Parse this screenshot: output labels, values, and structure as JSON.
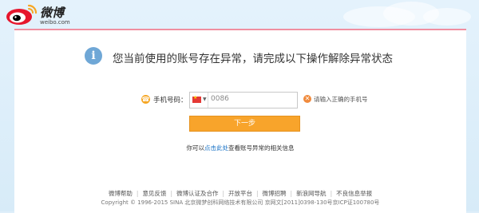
{
  "brand": {
    "name": "微博",
    "domain": "weibo.com"
  },
  "notice": {
    "text": "您当前使用的账号存在异常，请完成以下操作解除异常状态"
  },
  "phone": {
    "label": "手机号码：",
    "country_code": "0086",
    "value": "",
    "error_text": "请输入正确的手机号"
  },
  "next_button": {
    "label": "下一步"
  },
  "help": {
    "prefix": "你可以",
    "link": "点击此处",
    "suffix": "查看账号异常的相关信息"
  },
  "footer": {
    "links": [
      "微博帮助",
      "意见反馈",
      "微博认证及合作",
      "开放平台",
      "微博招聘",
      "新浪网导航",
      "不良信息举报"
    ],
    "copyright": "Copyright © 1996-2015 SINA 北京微梦创科网络技术有限公司 京网文[2011]0398-130号京ICP证100780号"
  },
  "colors": {
    "accent_orange": "#f8a42b",
    "link_blue": "#1a73c6",
    "header_border": "#f08fa0",
    "background": "#dfeffa"
  }
}
